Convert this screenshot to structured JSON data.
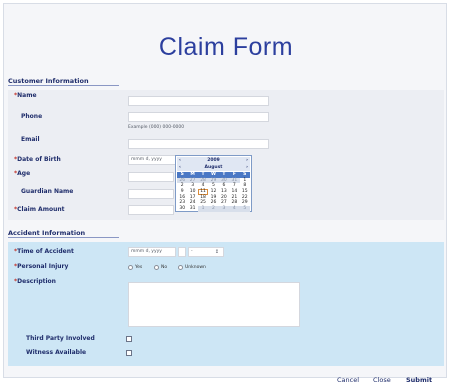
{
  "form": {
    "title": "Claim Form"
  },
  "customer": {
    "heading": "Customer Information",
    "name_label": "Name",
    "phone_label": "Phone",
    "phone_hint": "Example (000) 000-0000",
    "email_label": "Email",
    "dob_label": "Date of Birth",
    "dob_placeholder": "mmm d, yyyy",
    "age_label": "Age",
    "guardian_label": "Guardian Name",
    "claim_amount_label": "Claim Amount",
    "required_marker": "*"
  },
  "calendar": {
    "year": "2009",
    "month": "August",
    "prev_label": "‹",
    "next_label": "›",
    "weekdays": [
      "S",
      "M",
      "T",
      "W",
      "T",
      "F",
      "S"
    ],
    "weeks": [
      [
        "26",
        "27",
        "28",
        "29",
        "30",
        "31",
        "1"
      ],
      [
        "2",
        "3",
        "4",
        "5",
        "6",
        "7",
        "8"
      ],
      [
        "9",
        "10",
        "11",
        "12",
        "13",
        "14",
        "15"
      ],
      [
        "16",
        "17",
        "18",
        "19",
        "20",
        "21",
        "22"
      ],
      [
        "23",
        "24",
        "25",
        "26",
        "27",
        "28",
        "29"
      ],
      [
        "30",
        "31",
        "1",
        "2",
        "3",
        "4",
        "5"
      ]
    ],
    "selected": "11"
  },
  "accident": {
    "heading": "Accident Information",
    "time_label": "Time of Accident",
    "time_placeholder": "mmm d, yyyy",
    "time_select_value": "-",
    "personal_injury_label": "Personal Injury",
    "injury_options": [
      "Yes",
      "No",
      "Unknown"
    ],
    "description_label": "Description",
    "third_party_label": "Third Party Involved",
    "witness_label": "Witness Available"
  },
  "actions": {
    "cancel": "Cancel",
    "close": "Close",
    "submit": "Submit"
  },
  "colors": {
    "title": "#2c3f9e",
    "accident_bg": "#cde6f5",
    "calendar_header": "#4a78c5",
    "required": "#c2342b"
  }
}
